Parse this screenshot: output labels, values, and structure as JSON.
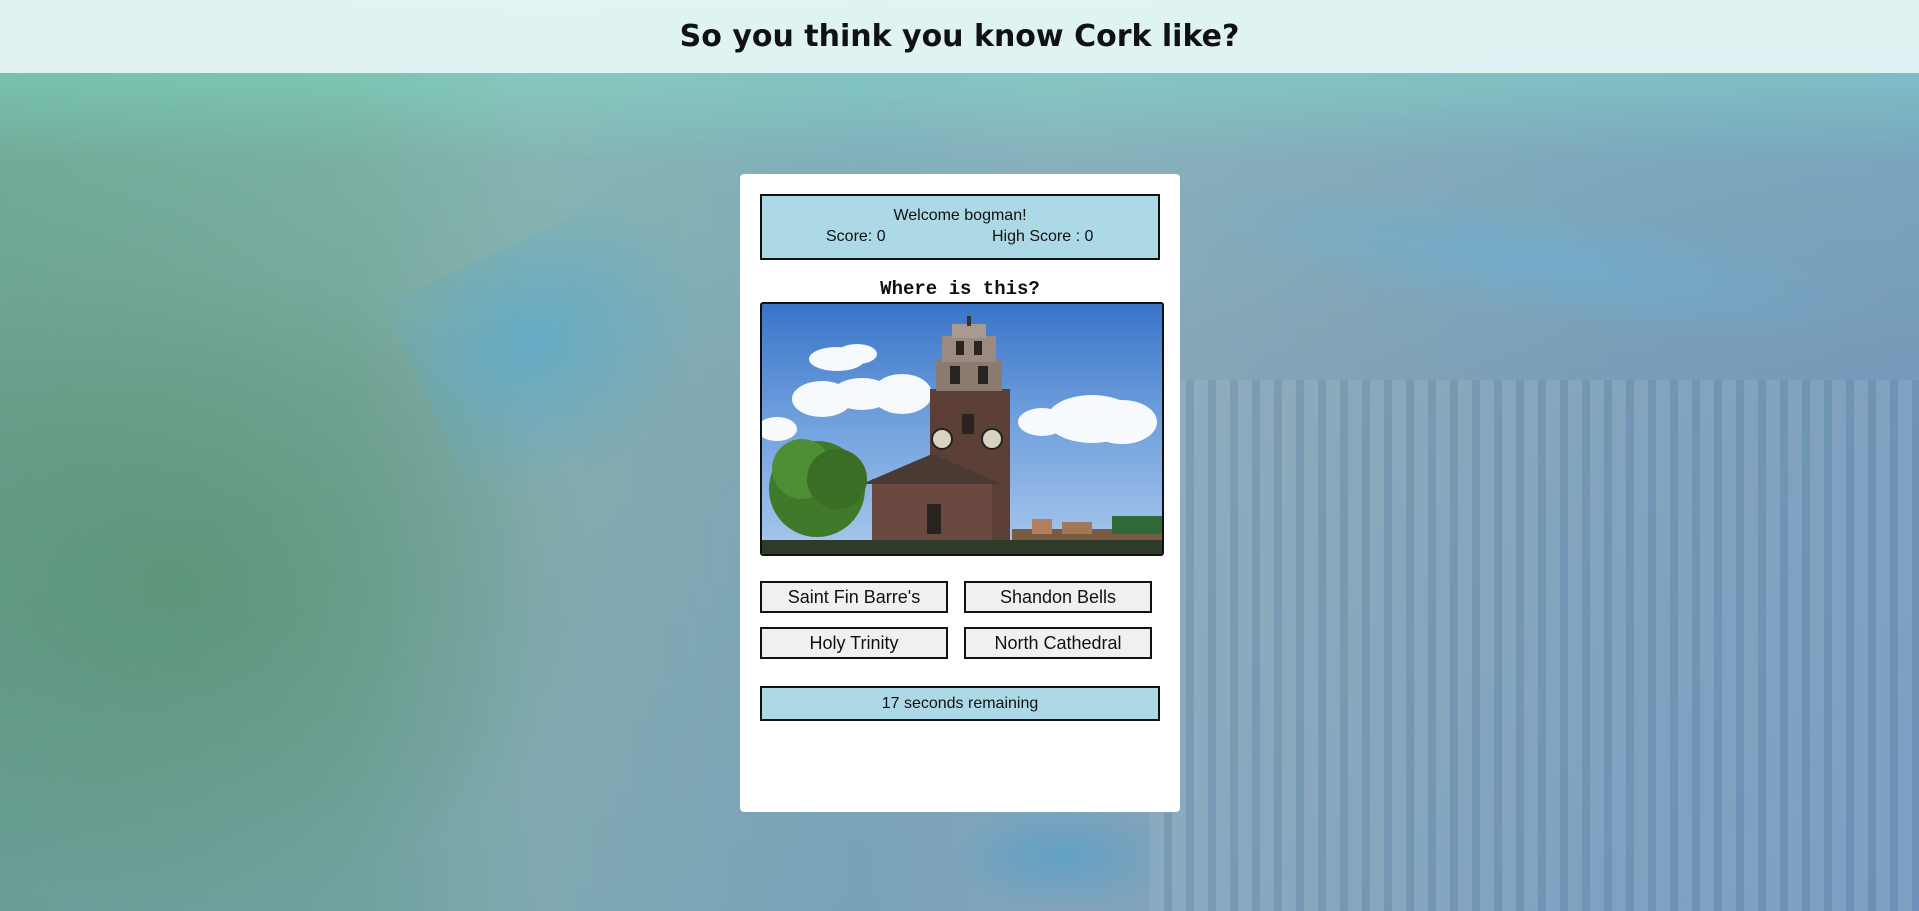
{
  "header": {
    "title": "So you think you know Cork like?"
  },
  "scoreboard": {
    "welcome": "Welcome bogman!",
    "score": "Score: 0",
    "high_score": "High Score : 0"
  },
  "question": {
    "text": "Where is this?"
  },
  "answers": [
    {
      "label": "Saint Fin Barre's"
    },
    {
      "label": "Shandon Bells"
    },
    {
      "label": "Holy Trinity"
    },
    {
      "label": "North Cathedral"
    }
  ],
  "timer": {
    "text": "17 seconds remaining"
  },
  "colors": {
    "panel_blue": "#add8e6",
    "button_bg": "#f0f0f0",
    "header_bg": "#e8f6f6"
  }
}
